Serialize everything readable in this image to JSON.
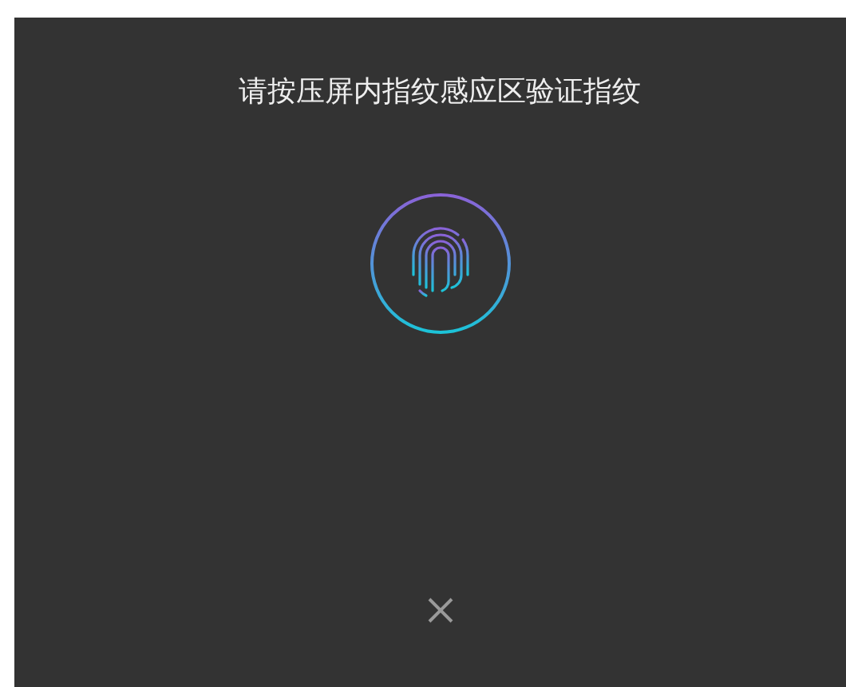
{
  "prompt": "请按压屏内指纹感应区验证指纹"
}
